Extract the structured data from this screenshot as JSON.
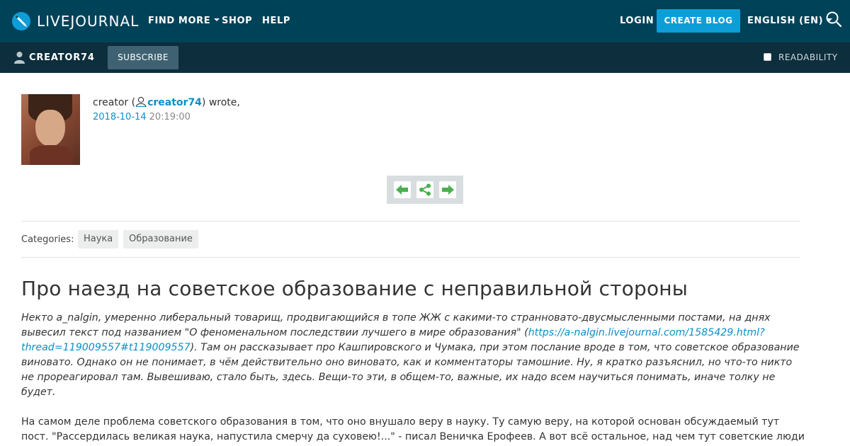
{
  "header": {
    "brand": "LIVEJOURNAL",
    "nav": [
      "FIND MORE",
      "SHOP",
      "HELP"
    ],
    "login": "LOGIN",
    "create_blog": "CREATE BLOG",
    "language": "ENGLISH (EN)",
    "colors": {
      "bar": "#004359",
      "accent": "#0e9ed7"
    }
  },
  "journal_bar": {
    "name": "CREATOR74",
    "subscribe": "SUBSCRIBE",
    "readability": "READABILITY",
    "readability_checked": false
  },
  "post": {
    "author_display": "creator",
    "open_paren": " (",
    "username": "creator74",
    "wrote": ") wrote,",
    "date": "2018-10-14",
    "time": "20:19:00",
    "nav_icons": [
      "prev-arrow-icon",
      "share-icon",
      "next-arrow-icon"
    ],
    "categories_label": "Categories:",
    "categories": [
      "Наука",
      "Образование"
    ],
    "title": "Про наезд на советское образование с неправильной стороны",
    "intro_part1": "Некто a_nalgin, умеренно либеральный товарищ, продвигающийся в топе ЖЖ с какими-то странновато-двусмысленными постами, на днях вывесил текст под названием \"О феноменальном последствии лучшего в мире образования\" (",
    "intro_link": "https://a-nalgin.livejournal.com/1585429.html?thread=119009557#t119009557",
    "intro_part2": "). Там он рассказывает про Кашпировского и Чумака, при этом послание вроде в том, что советское образование виновато. Однако он не понимает, в чём действительно оно виновато, как и комментаторы тамошние. Ну, я кратко разъяснил, но что-то никто не прореагировал там. Вывешиваю, стало быть, здесь. Вещи-то эти, в общем-то, важные, их надо всем научиться понимать, иначе толку не будет.",
    "body": "На самом деле проблема советского образования в том, что оно внушало веру в науку. Ту самую веру, на которой основан обсуждаемый тут пост. \"Рассердилась великая наука, напустила смерчу да суховею!...\" - писал Веничка Ерофеев. А вот всё остальное, над чем тут советские люди глумятся - это"
  }
}
